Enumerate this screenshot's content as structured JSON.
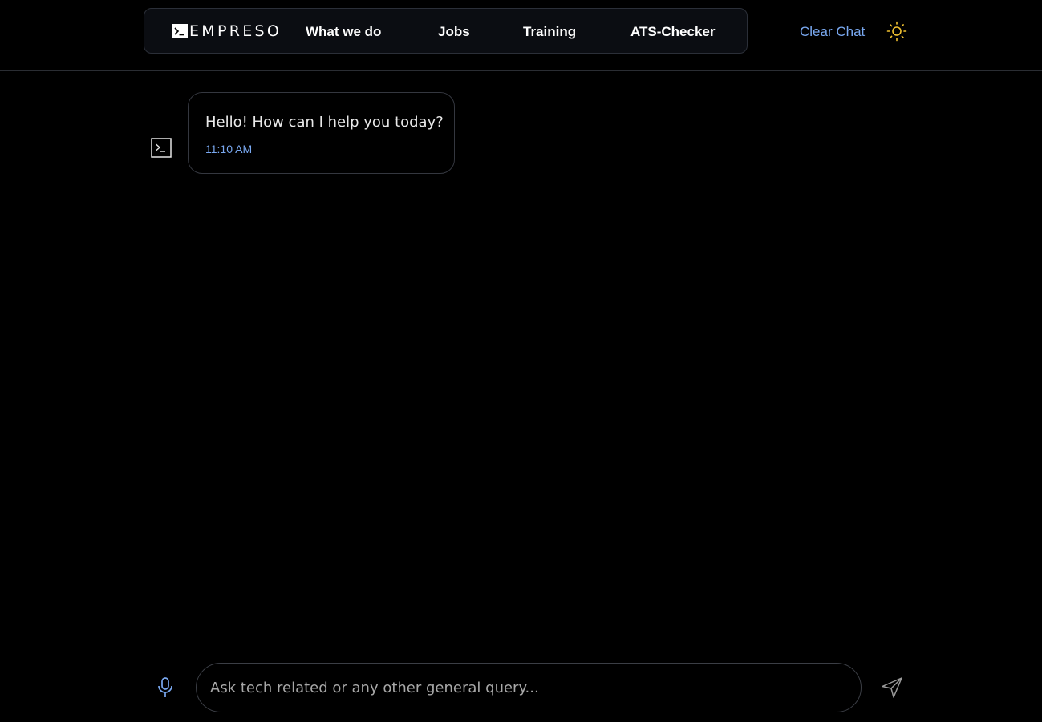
{
  "header": {
    "logo_text": "EMPRESO",
    "nav": [
      {
        "label": "What we do"
      },
      {
        "label": "Jobs"
      },
      {
        "label": "Training"
      },
      {
        "label": "ATS-Checker"
      }
    ],
    "clear_chat_label": "Clear Chat",
    "theme_icon": "sun-icon"
  },
  "chat": {
    "messages": [
      {
        "sender": "bot",
        "avatar_icon": "terminal-icon",
        "text": "Hello! How can I help you today?",
        "time": "11:10 AM"
      }
    ]
  },
  "composer": {
    "mic_icon": "microphone-icon",
    "placeholder": "Ask tech related or any other general query...",
    "value": "",
    "send_icon": "send-icon"
  },
  "colors": {
    "background": "#000000",
    "accent": "#79a8f0",
    "sun": "#f2c230",
    "border": "#34373f"
  }
}
